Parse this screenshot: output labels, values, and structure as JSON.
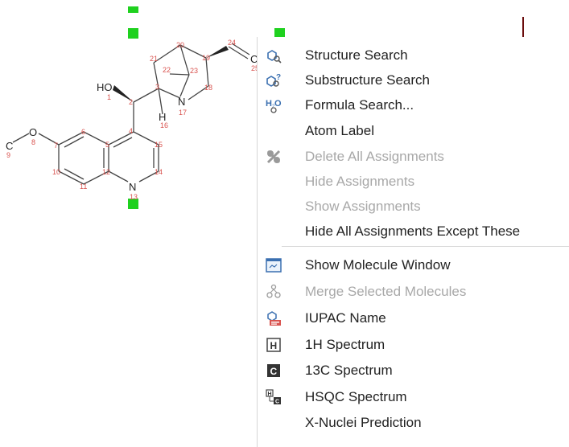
{
  "molecule": {
    "atom_labels": {
      "oh": "HO",
      "o8": "O",
      "c9": "C",
      "n17": "N",
      "h16": "H",
      "n13": "N",
      "c25": "C"
    },
    "atom_numbers": [
      "1",
      "2",
      "3",
      "4",
      "5",
      "6",
      "7",
      "8",
      "9",
      "10",
      "11",
      "12",
      "13",
      "14",
      "15",
      "16",
      "17",
      "18",
      "19",
      "20",
      "21",
      "22",
      "23",
      "24",
      "25"
    ]
  },
  "menu": {
    "items": [
      {
        "label": "Structure Search",
        "icon": "structure-search-icon",
        "enabled": true
      },
      {
        "label": "Substructure Search",
        "icon": "substructure-search-icon",
        "enabled": true
      },
      {
        "label": "Formula Search...",
        "icon": "formula-search-icon",
        "enabled": true
      },
      {
        "label": "Atom Label",
        "icon": "",
        "enabled": true
      },
      {
        "label": "Delete All Assignments",
        "icon": "delete-assignments-icon",
        "enabled": false
      },
      {
        "label": "Hide Assignments",
        "icon": "",
        "enabled": false
      },
      {
        "label": "Show Assignments",
        "icon": "",
        "enabled": false
      },
      {
        "label": "Hide All Assignments Except These",
        "icon": "",
        "enabled": true
      },
      {
        "label": "Show Molecule Window",
        "icon": "molecule-window-icon",
        "enabled": true
      },
      {
        "label": "Merge Selected Molecules",
        "icon": "merge-molecules-icon",
        "enabled": false
      },
      {
        "label": "IUPAC Name",
        "icon": "iupac-name-icon",
        "enabled": true
      },
      {
        "label": "1H Spectrum",
        "icon": "1h-spectrum-icon",
        "enabled": true
      },
      {
        "label": "13C Spectrum",
        "icon": "13c-spectrum-icon",
        "enabled": true
      },
      {
        "label": "HSQC Spectrum",
        "icon": "hsqc-spectrum-icon",
        "enabled": true
      },
      {
        "label": "X-Nuclei Prediction",
        "icon": "",
        "enabled": true
      }
    ],
    "formula_icon_text": "H2O",
    "h_icon_text": "H",
    "c_icon_text": "C"
  },
  "colors": {
    "selection_handle": "#1fd11f",
    "atom_number": "#d9534f",
    "disabled_text": "#a8a8a8",
    "icon_blue": "#3a6fb0"
  }
}
